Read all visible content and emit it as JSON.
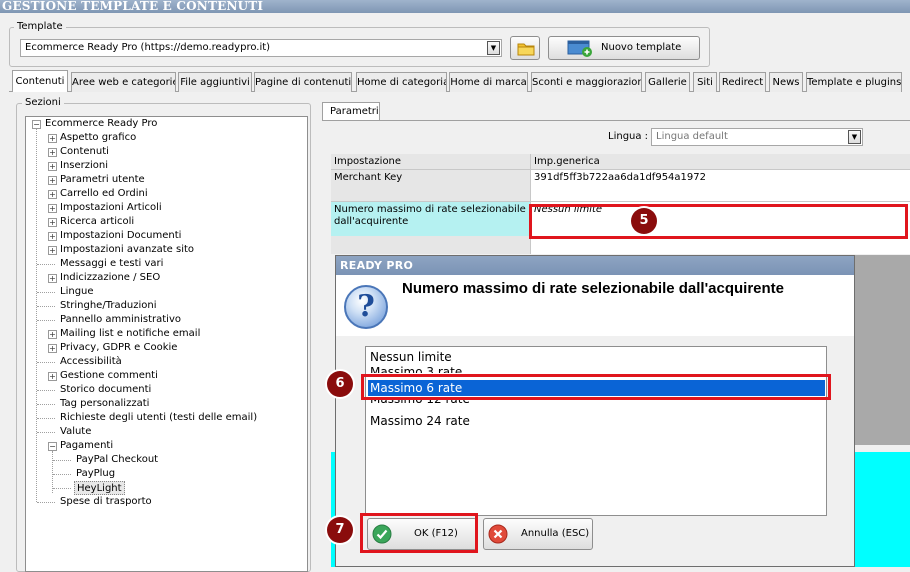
{
  "window": {
    "title": "GESTIONE TEMPLATE E CONTENUTI"
  },
  "template": {
    "label": "Template",
    "selected": "Ecommerce Ready Pro (https://demo.readypro.it)",
    "new_button": "Nuovo template"
  },
  "tabs": [
    "Contenuti",
    "Aree web e categorie",
    "File aggiuntivi",
    "Pagine di contenuti",
    "Home di categoria",
    "Home di marca",
    "Sconti e maggiorazioni",
    "Gallerie",
    "Siti",
    "Redirect",
    "News",
    "Template e plugins"
  ],
  "sections": {
    "label": "Sezioni",
    "root": "Ecommerce Ready Pro",
    "items": [
      "Aspetto grafico",
      "Contenuti",
      "Inserzioni",
      "Parametri utente",
      "Carrello ed Ordini",
      "Impostazioni Articoli",
      "Ricerca articoli",
      "Impostazioni Documenti",
      "Impostazioni avanzate sito",
      "Messaggi e testi vari",
      "Indicizzazione / SEO",
      "Lingue",
      "Stringhe/Traduzioni",
      "Pannello amministrativo",
      "Mailing list e notifiche email",
      "Privacy, GDPR e Cookie",
      "Accessibilità",
      "Gestione commenti",
      "Storico documenti",
      "Tag personalizzati",
      "Richieste degli utenti (testi delle email)",
      "Valute",
      "Pagamenti"
    ],
    "payment_children": [
      "PayPal Checkout",
      "PayPlug",
      "HeyLight"
    ],
    "last_item": "Spese di trasporto"
  },
  "parametri": {
    "tab_label": "Parametri",
    "language_label": "Lingua :",
    "language_value": "Lingua default",
    "grid": {
      "header_setting": "Impostazione",
      "header_value": "Imp.generica",
      "rows": [
        {
          "setting": "Merchant Key",
          "value": "391df5ff3b722aa6da1df954a1972"
        },
        {
          "setting": "Numero massimo di rate selezionabile dall'acquirente",
          "value": "Nessun limite"
        }
      ]
    }
  },
  "dialog": {
    "title": "READY PRO",
    "message": "Numero massimo di rate selezionabile dall'acquirente",
    "options": [
      "Nessun limite",
      "Massimo 3 rate",
      "Massimo 6 rate",
      "Massimo 12 rate",
      "Massimo 24 rate"
    ],
    "selected_option": "Massimo 6 rate",
    "ok_label": "OK (F12)",
    "cancel_label": "Annulla (ESC)"
  },
  "steps": {
    "five": "5",
    "six": "6",
    "seven": "7"
  },
  "colors": {
    "highlight": "#e0151d",
    "badge": "#8a0c0c",
    "selection": "#0a64d6",
    "cyan": "#00ffff"
  }
}
